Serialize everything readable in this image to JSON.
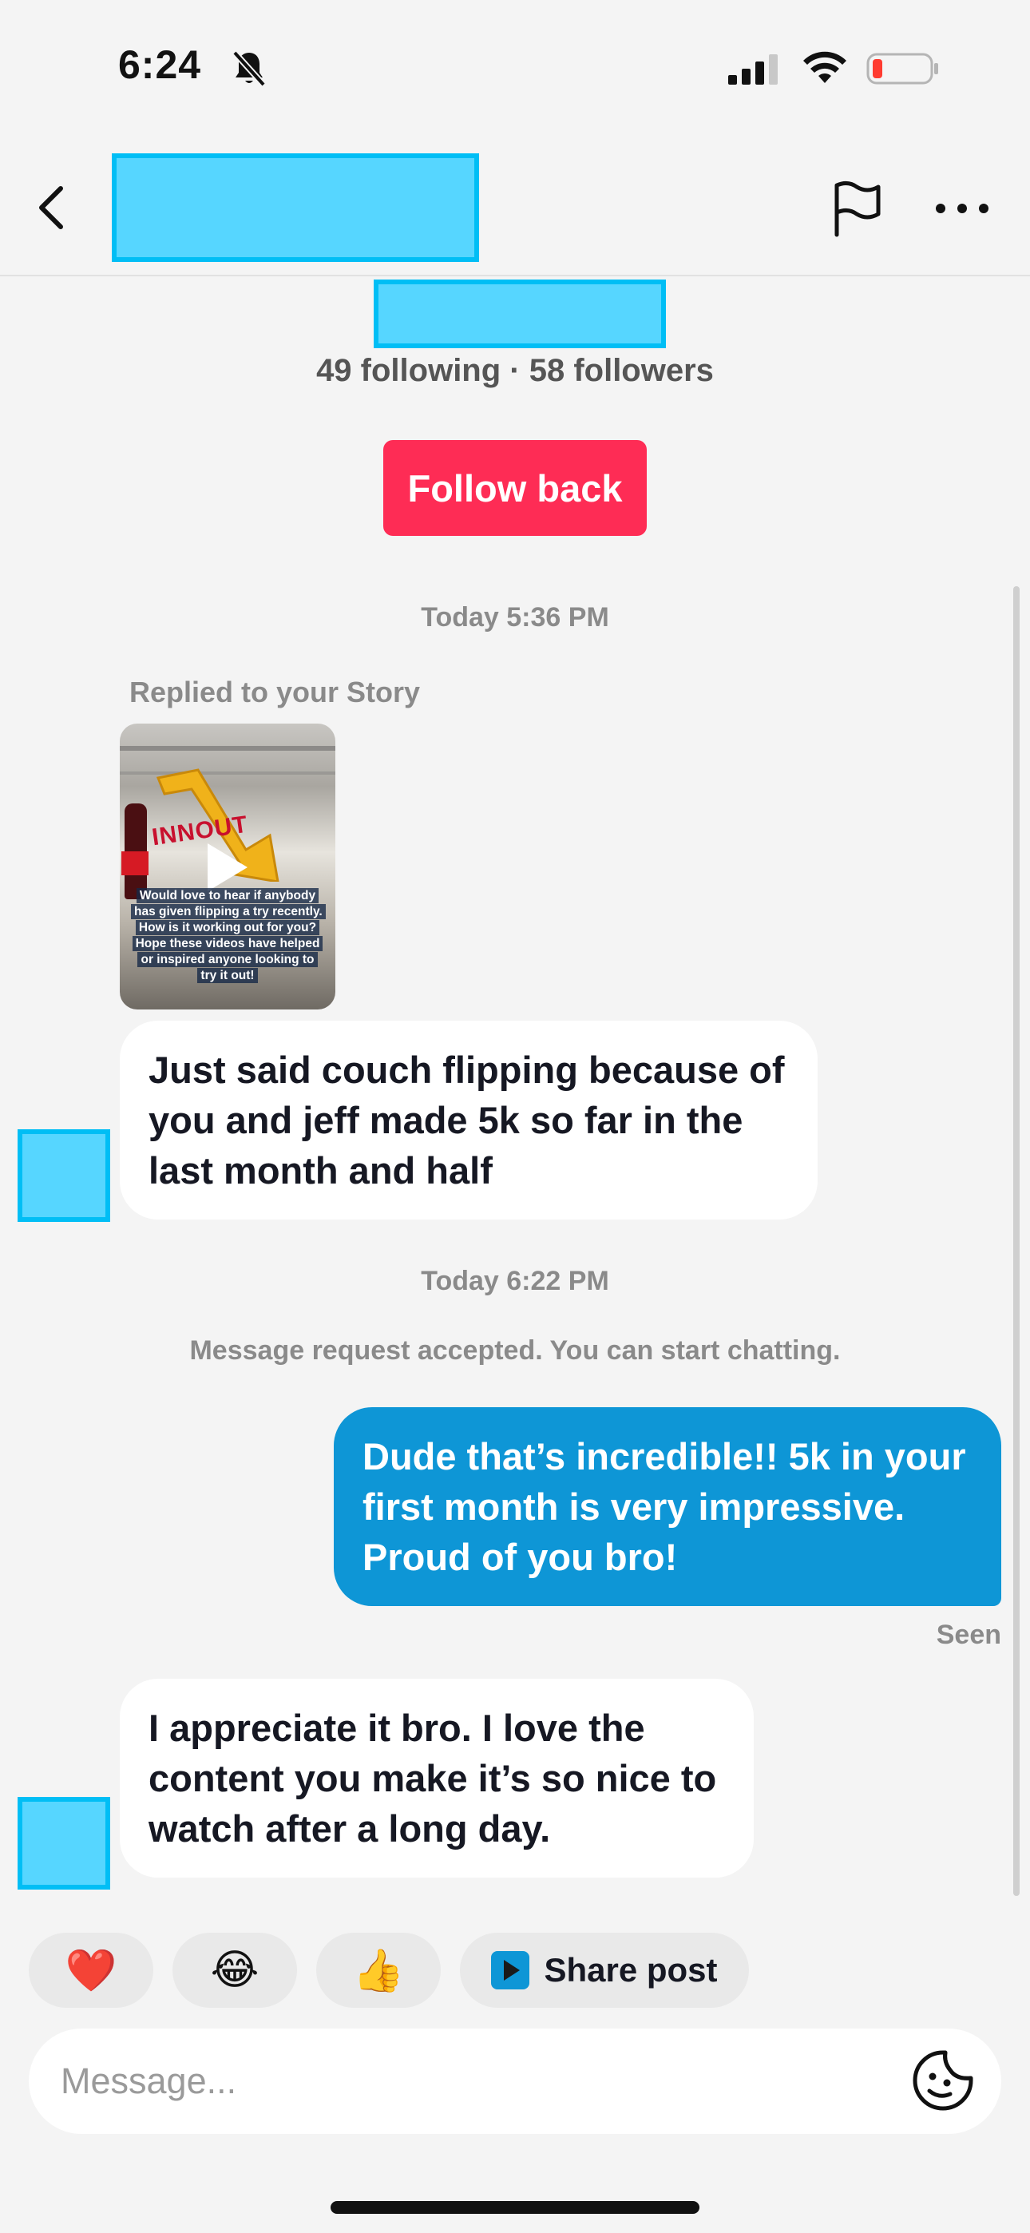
{
  "status_bar": {
    "time": "6:24",
    "icons": [
      "bell-off-icon",
      "signal-icon",
      "wifi-icon",
      "battery-low-icon"
    ]
  },
  "header": {
    "icons": [
      "chevron-left-icon",
      "flag-icon",
      "more-icon"
    ],
    "name": ""
  },
  "profile": {
    "handle": "",
    "stats": "49 following · 58 followers",
    "follow_back_label": "Follow back"
  },
  "conversation": {
    "timestamp_1": "Today 5:36 PM",
    "replied_label": "Replied to your Story",
    "story_caption": "Would love to hear if anybody has given flipping a try recently. How is it working out for you? Hope these videos have helped or inspired anyone looking to try it out!",
    "story_sign_text": "INNOUT",
    "message_1": "Just said couch flipping because of you and jeff made 5k so far in the last month and half",
    "timestamp_2": "Today 6:22 PM",
    "system_note": "Message request accepted. You can start chatting.",
    "message_2": "Dude that’s incredible!! 5k in your first month is very impressive. Proud of you bro!",
    "seen_label": "Seen",
    "message_3": "I appreciate it bro. I love the content you make it’s so nice to watch after a long day."
  },
  "quick_replies": {
    "heart": "❤️",
    "laugh": "😂",
    "thumbs_up": "👍",
    "share_post": "Share post"
  },
  "composer": {
    "placeholder": "Message...",
    "value": ""
  },
  "colors": {
    "follow_button": "#fe2c55",
    "outgoing_bubble": "#0e96d6",
    "incoming_bubble": "#ffffff",
    "redaction": "#56d6ff"
  }
}
